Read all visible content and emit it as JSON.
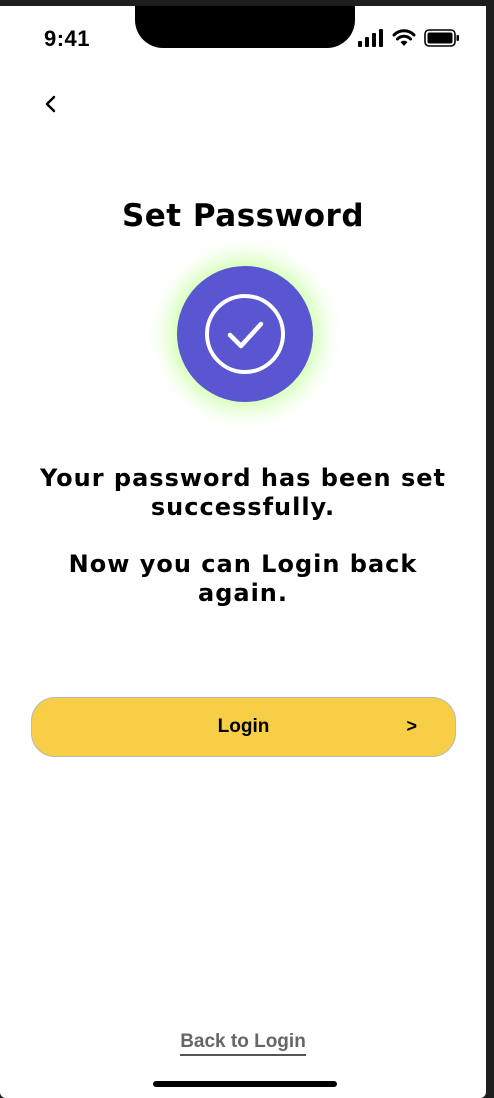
{
  "status_bar": {
    "time": "9:41",
    "icons": [
      "signal-icon",
      "wifi-icon",
      "battery-icon"
    ]
  },
  "header": {
    "back_icon": "chevron-left-icon",
    "title": "Set Password"
  },
  "success": {
    "icon": "check-circle-icon",
    "circle_color": "#5a56d2",
    "glow_color": "#aaff6e"
  },
  "messages": {
    "line1": "Your password has been set successfully.",
    "line2": "Now you can Login back again."
  },
  "login_button": {
    "label": "Login",
    "arrow": ">",
    "color": "#f7ce46"
  },
  "footer": {
    "back_to_login": "Back to Login"
  }
}
